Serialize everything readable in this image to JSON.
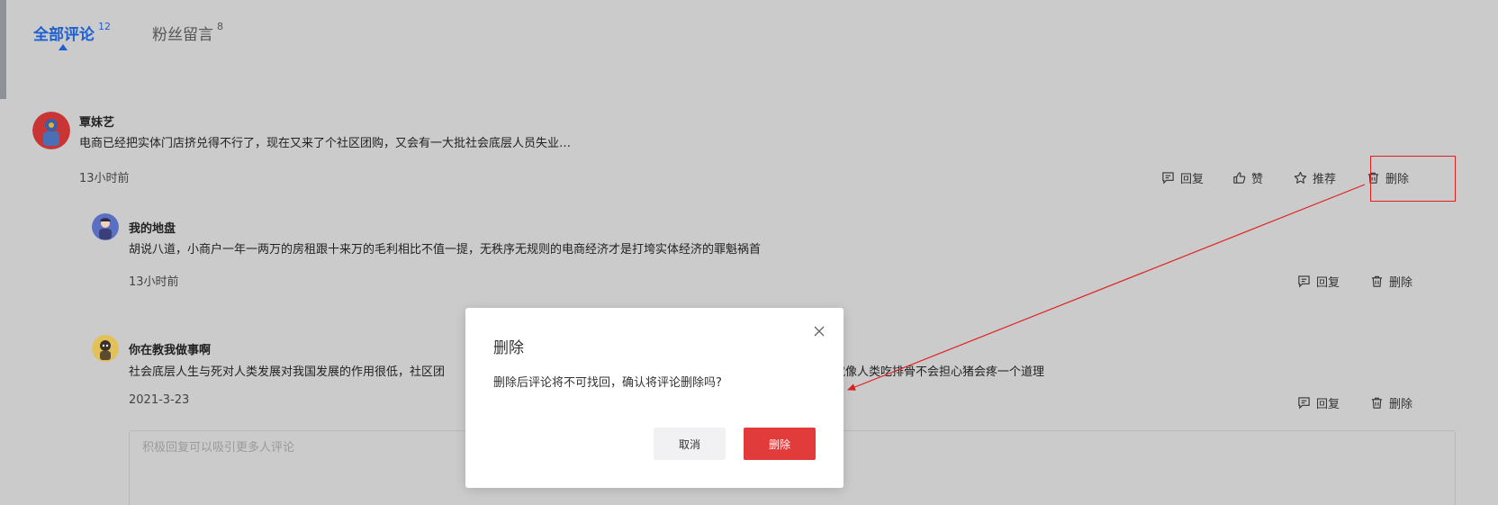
{
  "tabs": [
    {
      "label": "全部评论",
      "count": "12"
    },
    {
      "label": "粉丝留言",
      "count": "8"
    }
  ],
  "comments": [
    {
      "author": "覃妹艺",
      "content": "电商已经把实体门店挤兑得不行了，现在又来了个社区团购，又会有一大批社会底层人员失业…",
      "time": "13小时前"
    },
    {
      "author": "我的地盘",
      "content": "胡说八道，小商户一年一两万的房租跟十来万的毛利相比不值一提，无秩序无规则的电商经济才是打垮实体经济的罪魁祸首",
      "time": "13小时前"
    },
    {
      "author": "你在教我做事啊",
      "content_left": "社会底层人生与死对人类发展对我国发展的作用很低，社区团",
      "content_right": "就像人类吃排骨不会担心猪会疼一个道理",
      "time": "2021-3-23"
    }
  ],
  "actions": {
    "reply": "回复",
    "like": "赞",
    "recommend": "推荐",
    "delete": "删除"
  },
  "icons": {
    "reply": "comment-icon",
    "like": "thumbs-up-icon",
    "recommend": "star-icon",
    "delete": "trash-icon",
    "close": "close-icon"
  },
  "reply_box": {
    "placeholder": "积极回复可以吸引更多人评论"
  },
  "modal": {
    "title": "删除",
    "message": "删除后评论将不可找回，确认将评论删除吗?",
    "cancel_label": "取消",
    "confirm_label": "删除"
  },
  "colors": {
    "accent": "#1f5fd1",
    "danger": "#e23b3b",
    "annotation": "#e02020"
  }
}
